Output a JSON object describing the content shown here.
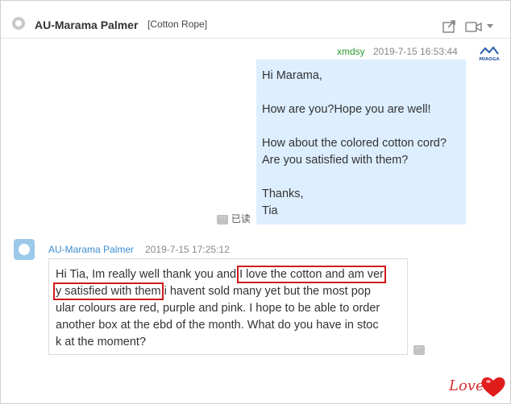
{
  "header": {
    "title": "AU-Marama Palmer",
    "tag": "[Cotton Rope]",
    "icons": [
      "share-icon",
      "video-icon",
      "chevron-down-icon"
    ]
  },
  "messages": [
    {
      "sender": "xmdsy",
      "time": "2019-7-15 16:53:44",
      "logo_text": "MIAOGA",
      "lines": [
        "Hi Marama,",
        "",
        "How are you?Hope you are well!",
        "",
        "How about the colored cotton cord?",
        "Are you satisfied with them?",
        "",
        "Thanks,",
        "Tia"
      ],
      "status": "已读"
    },
    {
      "sender": "AU-Marama Palmer",
      "time": "2019-7-15 17:25:12",
      "lines": [
        [
          "Hi Tia, Im really well thank you and ",
          "I love the cotton and am ver"
        ],
        [
          "y satisfied  with them",
          " i havent sold many yet but the most pop"
        ],
        [
          "ular colours are red, purple and pink. I hope to be able to order"
        ],
        [
          "another box at the ebd of the month. What do you have in stoc"
        ],
        [
          "k at the moment?"
        ]
      ]
    }
  ],
  "watermark": "Love",
  "colors": {
    "bubble_me": "#ddeeff",
    "highlight": "#d01818",
    "sender_me": "#2e9b2e",
    "sender_other": "#3a8bd0"
  }
}
